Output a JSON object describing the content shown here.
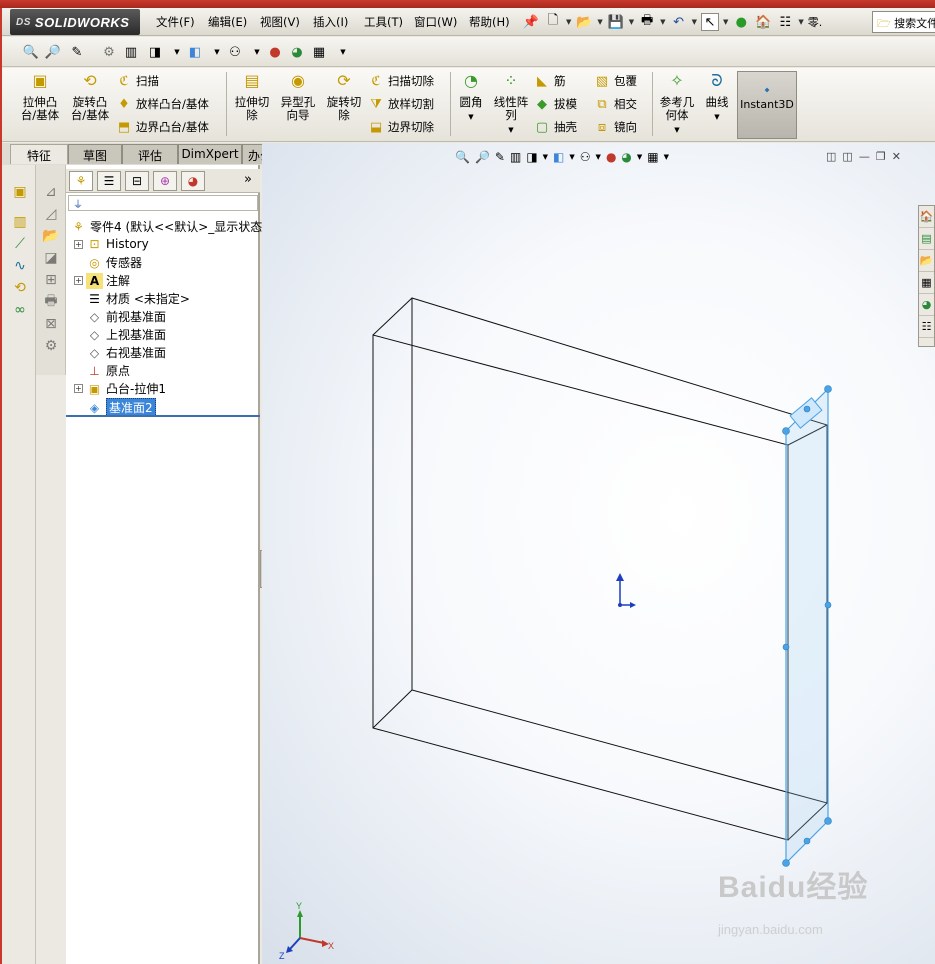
{
  "app": {
    "brand": "SOLIDWORKS",
    "brand_prefix": "DS"
  },
  "menu": [
    "文件(F)",
    "编辑(E)",
    "视图(V)",
    "插入(I)",
    "工具(T)",
    "窗口(W)",
    "帮助(H)"
  ],
  "quick_overflow": "零.",
  "search": {
    "placeholder": "搜索文件"
  },
  "features": {
    "extrude_boss": "拉伸凸\n台/基体",
    "revolve_boss": "旋转凸\n台/基体",
    "sweep": "扫描",
    "loft_boss": "放样凸台/基体",
    "boundary_boss": "边界凸台/基体",
    "extrude_cut": "拉伸切\n除",
    "hole_wizard": "异型孔\n向导",
    "revolve_cut": "旋转切\n除",
    "sweep_cut": "扫描切除",
    "loft_cut": "放样切割",
    "boundary_cut": "边界切除",
    "fillet": "圆角",
    "linear_pattern": "线性阵\n列",
    "rib": "筋",
    "draft": "拔模",
    "shell": "抽壳",
    "wrap": "包覆",
    "intersect": "相交",
    "mirror": "镜向",
    "ref_geometry": "参考几\n何体",
    "curves": "曲线",
    "instant3d": "Instant3D"
  },
  "tabs": [
    "特征",
    "草图",
    "评估",
    "DimXpert",
    "办公室产品"
  ],
  "active_tab": 0,
  "tree": {
    "root": "零件4 (默认<<默认>_显示状态",
    "items": [
      {
        "label": "History",
        "expand": true
      },
      {
        "label": "传感器",
        "expand": false
      },
      {
        "label": "注解",
        "expand": true
      },
      {
        "label": "材质 <未指定>",
        "expand": false
      },
      {
        "label": "前视基准面",
        "expand": false
      },
      {
        "label": "上视基准面",
        "expand": false
      },
      {
        "label": "右视基准面",
        "expand": false
      },
      {
        "label": "原点",
        "expand": false
      },
      {
        "label": "凸台-拉伸1",
        "expand": true
      },
      {
        "label": "基准面2",
        "expand": false,
        "selected": true
      }
    ],
    "more": "»"
  },
  "triad": {
    "x": "X",
    "y": "Y",
    "z": "Z"
  },
  "watermark": {
    "main": "Baidu经验",
    "sub": "jingyan.baidu.com"
  },
  "colors": {
    "selection": "#3b86d8",
    "plane": "#6fb1e8",
    "title_red": "#c8392c"
  }
}
